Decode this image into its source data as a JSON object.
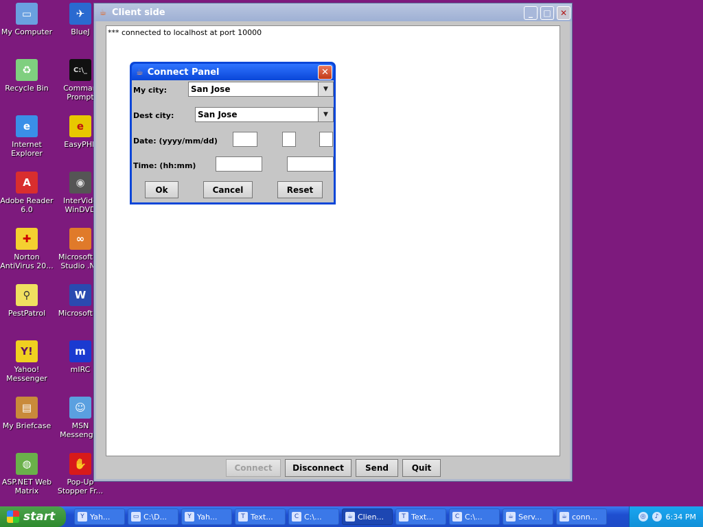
{
  "desktop": {
    "icons": [
      {
        "label": "My Computer",
        "icon": "computer-icon",
        "color": "#6aa0e0"
      },
      {
        "label": "Recycle Bin",
        "icon": "recycle-bin-icon",
        "color": "#7fcf7f"
      },
      {
        "label": "Internet\nExplorer",
        "icon": "internet-explorer-icon",
        "color": "#3a8fe8"
      },
      {
        "label": "Adobe Reader\n6.0",
        "icon": "adobe-reader-icon",
        "color": "#d92e2e"
      },
      {
        "label": "Norton\nAntiVirus 20...",
        "icon": "norton-antivirus-icon",
        "color": "#f4d030"
      },
      {
        "label": "PestPatrol",
        "icon": "pestpatrol-icon",
        "color": "#f0e060"
      },
      {
        "label": "Yahoo!\nMessenger",
        "icon": "yahoo-messenger-icon",
        "color": "#f0d020"
      },
      {
        "label": "My Briefcase",
        "icon": "briefcase-icon",
        "color": "#c98a3a"
      },
      {
        "label": "ASP.NET Web\nMatrix",
        "icon": "aspnet-matrix-icon",
        "color": "#6ab04a"
      },
      {
        "label": "BlueJ",
        "icon": "bluej-icon",
        "color": "#2a6ad0"
      },
      {
        "label": "Comman\nPrompt",
        "icon": "command-prompt-icon",
        "color": "#111111"
      },
      {
        "label": "EasyPHP",
        "icon": "easyphp-icon",
        "color": "#e8c800"
      },
      {
        "label": "InterVide\nWinDVD",
        "icon": "windvd-icon",
        "color": "#555555"
      },
      {
        "label": "Microsoft Vi\nStudio .NE",
        "icon": "visual-studio-icon",
        "color": "#e07a2a"
      },
      {
        "label": "Microsoft W",
        "icon": "word-icon",
        "color": "#2a4ab0"
      },
      {
        "label": "mIRC",
        "icon": "mirc-icon",
        "color": "#1a3ad0"
      },
      {
        "label": "MSN\nMessenger",
        "icon": "msn-messenger-icon",
        "color": "#5aa0e0"
      },
      {
        "label": "Pop-Up\nStopper Fr...",
        "icon": "popup-stopper-icon",
        "color": "#d81a1a"
      }
    ]
  },
  "client_window": {
    "title": "Client side",
    "log_text": "*** connected to localhost at port 10000",
    "buttons": {
      "connect": "Connect",
      "disconnect": "Disconnect",
      "send": "Send",
      "quit": "Quit"
    }
  },
  "connect_panel": {
    "title": "Connect Panel",
    "my_city_label": "My city:",
    "my_city_value": "San Jose",
    "dest_city_label": "Dest city:",
    "dest_city_value": "San Jose",
    "date_label": "Date: (yyyy/mm/dd)",
    "time_label": "Time: (hh:mm)",
    "ok": "Ok",
    "cancel": "Cancel",
    "reset": "Reset"
  },
  "taskbar": {
    "start_label": "start",
    "tasks": [
      {
        "label": "Yah...",
        "icon": "yahoo-icon",
        "active": false
      },
      {
        "label": "C:\\D...",
        "icon": "folder-icon",
        "active": false
      },
      {
        "label": "Yah...",
        "icon": "yahoo-icon",
        "active": false
      },
      {
        "label": "Text...",
        "icon": "textpad-icon",
        "active": false
      },
      {
        "label": "C:\\...",
        "icon": "cmd-icon",
        "active": false
      },
      {
        "label": "Clien...",
        "icon": "java-icon",
        "active": true
      },
      {
        "label": "Text...",
        "icon": "textpad-icon",
        "active": false
      },
      {
        "label": "C:\\...",
        "icon": "cmd-icon",
        "active": false
      },
      {
        "label": "Serv...",
        "icon": "java-icon",
        "active": false
      },
      {
        "label": "conn...",
        "icon": "java-icon",
        "active": false
      }
    ],
    "clock": "6:34 PM"
  }
}
